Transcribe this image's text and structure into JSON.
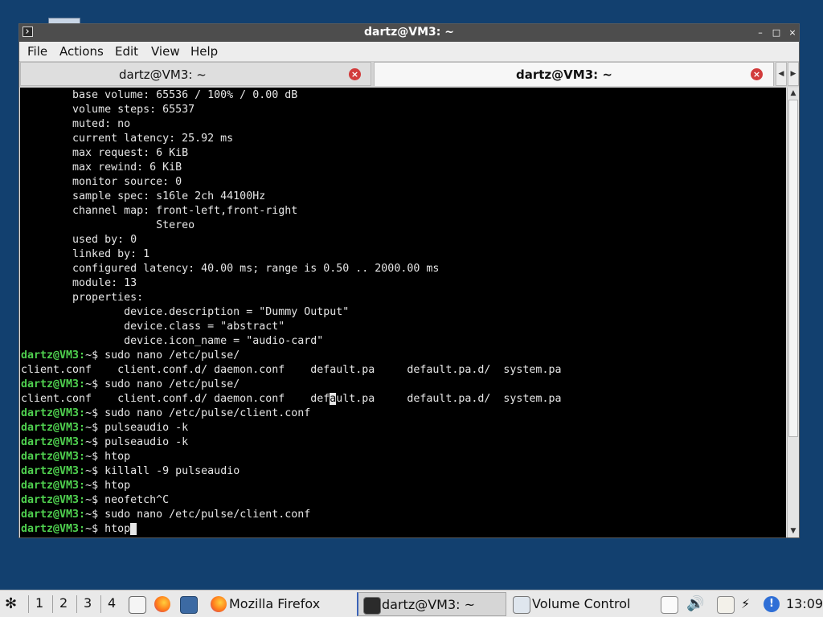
{
  "window": {
    "title": "dartz@VM3: ~",
    "buttons": {
      "minimize": "–",
      "maximize": "□",
      "close": "×"
    }
  },
  "menu": [
    "File",
    "Actions",
    "Edit",
    "View",
    "Help"
  ],
  "tabs": [
    {
      "label": "dartz@VM3: ~",
      "active": false
    },
    {
      "label": "dartz@VM3: ~",
      "active": true
    }
  ],
  "tab_scroll": {
    "left": "◀",
    "right": "▶"
  },
  "terminal": {
    "prompt": "dartz@VM3:",
    "prompt_suffix": "~$ ",
    "lines": [
      {
        "type": "out",
        "text": "        base volume: 65536 / 100% / 0.00 dB"
      },
      {
        "type": "out",
        "text": "        volume steps: 65537"
      },
      {
        "type": "out",
        "text": "        muted: no"
      },
      {
        "type": "out",
        "text": "        current latency: 25.92 ms"
      },
      {
        "type": "out",
        "text": "        max request: 6 KiB"
      },
      {
        "type": "out",
        "text": "        max rewind: 6 KiB"
      },
      {
        "type": "out",
        "text": "        monitor source: 0"
      },
      {
        "type": "out",
        "text": "        sample spec: s16le 2ch 44100Hz"
      },
      {
        "type": "out",
        "text": "        channel map: front-left,front-right"
      },
      {
        "type": "out",
        "text": "                     Stereo"
      },
      {
        "type": "out",
        "text": "        used by: 0"
      },
      {
        "type": "out",
        "text": "        linked by: 1"
      },
      {
        "type": "out",
        "text": "        configured latency: 40.00 ms; range is 0.50 .. 2000.00 ms"
      },
      {
        "type": "out",
        "text": "        module: 13"
      },
      {
        "type": "out",
        "text": "        properties:"
      },
      {
        "type": "out",
        "text": "                device.description = \"Dummy Output\""
      },
      {
        "type": "out",
        "text": "                device.class = \"abstract\""
      },
      {
        "type": "out",
        "text": "                device.icon_name = \"audio-card\""
      },
      {
        "type": "cmd",
        "text": "sudo nano /etc/pulse/"
      },
      {
        "type": "out",
        "text": "client.conf    client.conf.d/ daemon.conf    default.pa     default.pa.d/  system.pa"
      },
      {
        "type": "cmd",
        "text": "sudo nano /etc/pulse/"
      },
      {
        "type": "out_hl",
        "before": "client.conf    client.conf.d/ daemon.conf    def",
        "hl": "a",
        "after": "ult.pa     default.pa.d/  system.pa"
      },
      {
        "type": "cmd",
        "text": "sudo nano /etc/pulse/client.conf"
      },
      {
        "type": "cmd",
        "text": "pulseaudio -k"
      },
      {
        "type": "cmd",
        "text": "pulseaudio -k"
      },
      {
        "type": "cmd",
        "text": "htop"
      },
      {
        "type": "cmd",
        "text": "killall -9 pulseaudio"
      },
      {
        "type": "cmd",
        "text": "htop"
      },
      {
        "type": "cmd",
        "text": "neofetch^C"
      },
      {
        "type": "cmd",
        "text": "sudo nano /etc/pulse/client.conf"
      },
      {
        "type": "cmd_cursor",
        "text": "htop"
      }
    ]
  },
  "taskbar": {
    "workspaces": [
      "1",
      "2",
      "3",
      "4"
    ],
    "launchers": [
      "text-editor-icon",
      "firefox-icon",
      "monitor-icon"
    ],
    "tasks": [
      {
        "label": "Mozilla Firefox",
        "icon": "firefox-icon",
        "active": false
      },
      {
        "label": "dartz@VM3: ~",
        "icon": "terminal-icon",
        "active": true
      },
      {
        "label": "Volume Control",
        "icon": "volume-control-icon",
        "active": false
      }
    ],
    "tray": [
      "window-icon",
      "speaker-icon",
      "clipboard-icon",
      "network-icon",
      "info-icon"
    ],
    "clock": "13:09"
  },
  "colors": {
    "desktop": "#12406f",
    "prompt": "#4fd14f",
    "terminal_bg": "#000000",
    "terminal_fg": "#e6e6e6",
    "tab_close": "#d23b3b"
  }
}
